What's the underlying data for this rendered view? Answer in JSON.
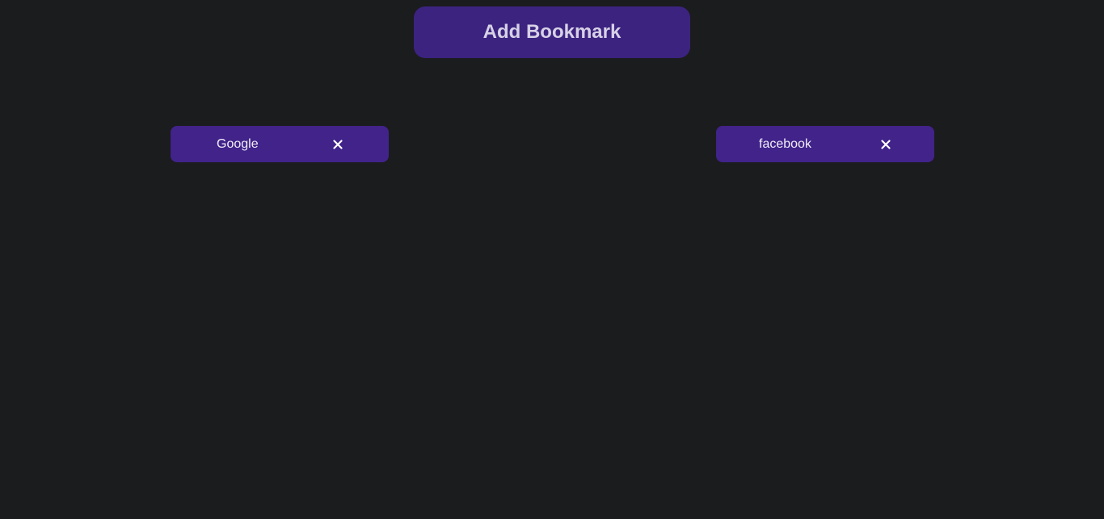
{
  "header": {
    "add_bookmark_label": "Add Bookmark"
  },
  "bookmarks": [
    {
      "label": "Google",
      "close_icon": "close-icon"
    },
    {
      "label": "facebook",
      "close_icon": "close-icon"
    }
  ],
  "colors": {
    "background": "#1b1c1e",
    "accent": "#3c2380",
    "bookmark_bg": "#41238a",
    "button_text": "#d7d1e6",
    "bookmark_text": "#f1eef8"
  }
}
